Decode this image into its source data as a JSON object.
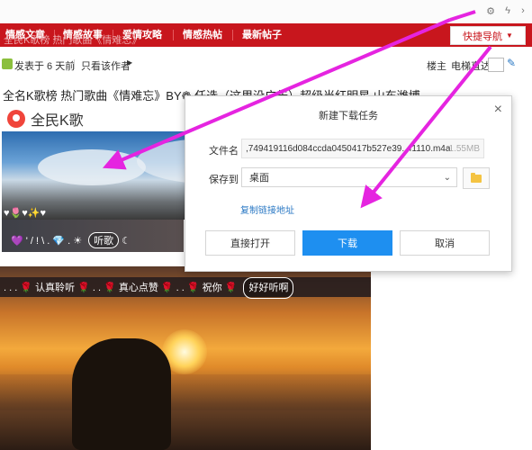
{
  "nav": {
    "items": [
      "情感文章",
      "情感故事",
      "爱情攻略",
      "情感热帖",
      "最新帖子"
    ],
    "quick_nav": "快捷导航"
  },
  "ghost_text": "全民K歌榜 热门歌曲《情难忘》",
  "meta": {
    "posted": "发表于 6 天前",
    "only_author": "只看该作者",
    "floor": "楼主",
    "jump_label": "电梯直达"
  },
  "post": {
    "title": "全名K歌榜 热门歌曲《情难忘》BY❁ 任选（这里没广告）超级当红明星 山东潍博"
  },
  "brand": {
    "name": "全民K歌"
  },
  "emoji_rows": {
    "row1": "♥🌷♥✨♥",
    "row2": "💜 ' / ! \\ . 💎 . ☀",
    "pill1": "听歌",
    "row3": ". . . 🌹 认真聆听 🌹 . . 🌹 真心点赞 🌹 . . 🌹 祝你 🌹",
    "pill2": "好好听啊"
  },
  "dialog": {
    "title": "新建下载任务",
    "filename_label": "文件名",
    "filename_value": ",749419116d084ccda0450417b527e39...f1110.m4a",
    "filesize": "1.55MB",
    "saveto_label": "保存到",
    "saveto_value": "桌面",
    "copy_link": "复制链接地址",
    "btn_open": "直接打开",
    "btn_download": "下载",
    "btn_cancel": "取消"
  },
  "colors": {
    "nav_red": "#c8161d",
    "primary_blue": "#1e8ff0",
    "annotation_arrow": "#e524e0"
  }
}
